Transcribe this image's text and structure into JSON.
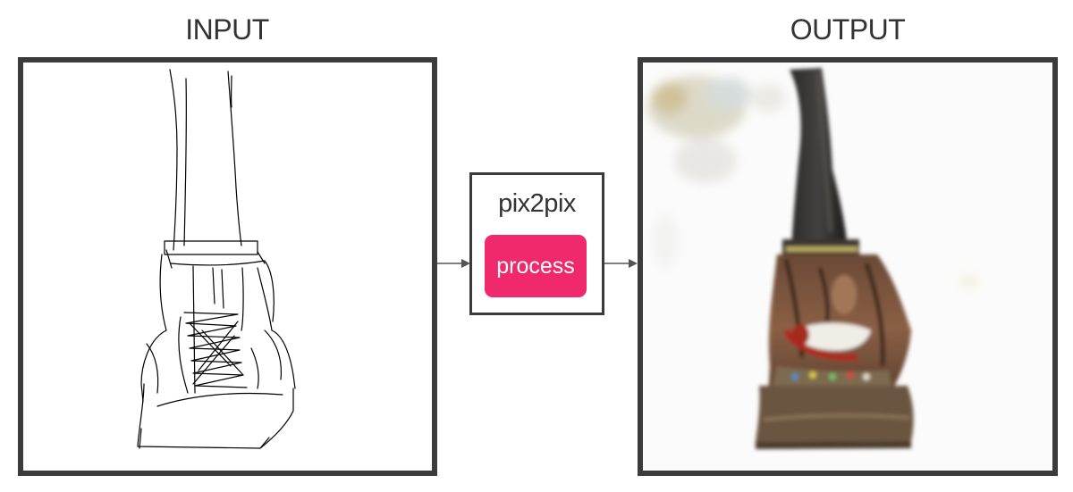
{
  "labels": {
    "input": "INPUT",
    "output": "OUTPUT"
  },
  "processor": {
    "model_name": "pix2pix",
    "button_label": "process"
  },
  "icons": {
    "arrow_in": "arrow-right-icon",
    "arrow_out": "arrow-right-icon"
  },
  "colors": {
    "button": "#f0286c",
    "frame": "#3b3b3b",
    "text": "#333333"
  }
}
